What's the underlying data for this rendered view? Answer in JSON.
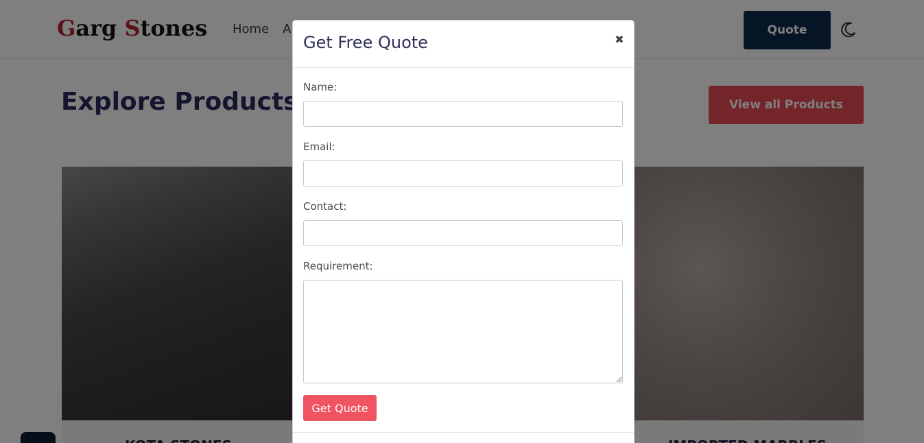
{
  "header": {
    "logo_parts": [
      "G",
      "arg ",
      "S",
      "tones"
    ],
    "nav": [
      "Home",
      "Al"
    ],
    "quote_label": "Quote",
    "theme_icon": "moon-icon"
  },
  "section": {
    "title": "Explore Products",
    "view_all_label": "View all Products"
  },
  "products": [
    {
      "caption": "KOTA STONES"
    },
    {
      "caption": "IMPORTED MARBLES"
    }
  ],
  "modal": {
    "title": "Get Free Quote",
    "close_glyph": "✖",
    "fields": {
      "name_label": "Name:",
      "name_value": "",
      "email_label": "Email:",
      "email_value": "",
      "contact_label": "Contact:",
      "contact_value": "",
      "requirement_label": "Requirement:",
      "requirement_value": ""
    },
    "submit_label": "Get Quote"
  },
  "colors": {
    "brand_navy": "#0c2b4b",
    "brand_red": "#e84b55",
    "submit_red": "#f05461",
    "title_indigo": "#2a2a5e"
  }
}
